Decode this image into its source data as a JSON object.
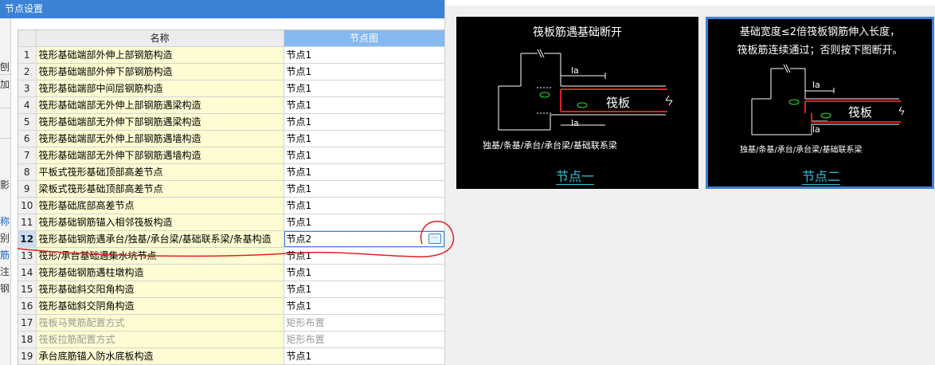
{
  "window": {
    "title": "节点设置"
  },
  "left_fragments": [
    "刨",
    "加",
    "影",
    "称",
    "别",
    "筋",
    "注",
    "钢"
  ],
  "table": {
    "headers": {
      "index": "",
      "name": "名称",
      "node": "节点图"
    },
    "rows": [
      {
        "index": "1",
        "name": "筏形基础端部外伸上部钢筋构造",
        "value": "节点1",
        "disabled": false
      },
      {
        "index": "2",
        "name": "筏形基础端部外伸下部钢筋构造",
        "value": "节点1",
        "disabled": false
      },
      {
        "index": "3",
        "name": "筏形基础端部中间层钢筋构造",
        "value": "节点1",
        "disabled": false
      },
      {
        "index": "4",
        "name": "筏形基础端部无外伸上部钢筋遇梁构造",
        "value": "节点1",
        "disabled": false
      },
      {
        "index": "5",
        "name": "筏形基础端部无外伸下部钢筋遇梁构造",
        "value": "节点1",
        "disabled": false
      },
      {
        "index": "6",
        "name": "筏形基础端部无外伸上部钢筋遇墙构造",
        "value": "节点1",
        "disabled": false
      },
      {
        "index": "7",
        "name": "筏形基础端部无外伸下部钢筋遇墙构造",
        "value": "节点1",
        "disabled": false
      },
      {
        "index": "8",
        "name": "平板式筏形基础顶部高差节点",
        "value": "节点1",
        "disabled": false
      },
      {
        "index": "9",
        "name": "梁板式筏形基础顶部高差节点",
        "value": "节点1",
        "disabled": false
      },
      {
        "index": "10",
        "name": "筏形基础底部高差节点",
        "value": "节点1",
        "disabled": false
      },
      {
        "index": "11",
        "name": "筏形基础钢筋锚入相邻筏板构造",
        "value": "节点1",
        "disabled": false
      },
      {
        "index": "12",
        "name": "筏形基础钢筋遇承台/独基/承台梁/基础联系梁/条基构造",
        "value": "节点2",
        "disabled": false,
        "selected": true
      },
      {
        "index": "13",
        "name": "筏形/承台基础遇集水坑节点",
        "value": "节点1",
        "disabled": false
      },
      {
        "index": "14",
        "name": "筏形基础钢筋遇柱墩构造",
        "value": "节点1",
        "disabled": false
      },
      {
        "index": "15",
        "name": "筏形基础斜交阳角构造",
        "value": "节点1",
        "disabled": false
      },
      {
        "index": "16",
        "name": "筏形基础斜交阴角构造",
        "value": "节点1",
        "disabled": false
      },
      {
        "index": "17",
        "name": "筏板马凳筋配置方式",
        "value": "矩形布置",
        "disabled": true
      },
      {
        "index": "18",
        "name": "筏板拉筋配置方式",
        "value": "矩形布置",
        "disabled": true
      },
      {
        "index": "19",
        "name": "承台底筋锚入防水底板构造",
        "value": "节点1",
        "disabled": false
      }
    ],
    "ellipsis_label": "···"
  },
  "node1": {
    "caption": "筏板筋遇基础断开",
    "slab_label": "筏板",
    "la_top": "la",
    "la_bottom": "la",
    "desc": "独基/条基/承台/承台梁/基础联系梁",
    "label": "节点一"
  },
  "node2": {
    "caption_line1": "基础宽度≤2倍筏板钢筋伸入长度，",
    "caption_line2": "筏板筋连续通过；否则按下图断开。",
    "slab_label": "筏板",
    "la_top": "la",
    "la_bottom": "la",
    "desc": "独基/条基/承台/承台梁/基础联系梁",
    "label": "节点二"
  },
  "colors": {
    "titlebar": "#3b82d6",
    "header_active": "#86b9ef",
    "name_cell": "#fdfcd2",
    "annotation": "#e02020",
    "node_label": "#2fc2d6",
    "selected_border": "#3b82d6"
  }
}
